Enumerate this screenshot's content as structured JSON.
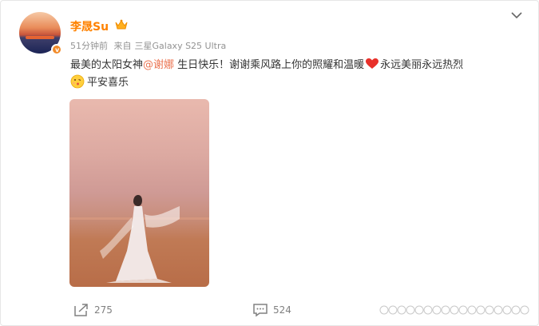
{
  "user": {
    "name": "李晟Su",
    "verified_symbol": "v"
  },
  "meta": {
    "time": "51分钟前",
    "source_prefix": "来自",
    "device": "三星Galaxy S25 Ultra"
  },
  "post": {
    "text_before": "最美的太阳女神",
    "mention": "@谢娜",
    "text_middle": " 生日快乐！谢谢乘风路上你的照耀和温暖",
    "text_after": "永远美丽永远热烈",
    "line2": "平安喜乐"
  },
  "icons": {
    "crown": "crown-icon",
    "more": "chevron-down-icon",
    "heart": "heart-icon",
    "emoji": "kiss-face-icon",
    "repost": "repost-icon",
    "comment": "comment-icon"
  },
  "colors": {
    "username": "#ff8200",
    "mention": "#eb7350",
    "meta": "#939393",
    "heart": "#e8302a"
  },
  "actions": {
    "repost_count": "275",
    "comment_count": "524"
  }
}
